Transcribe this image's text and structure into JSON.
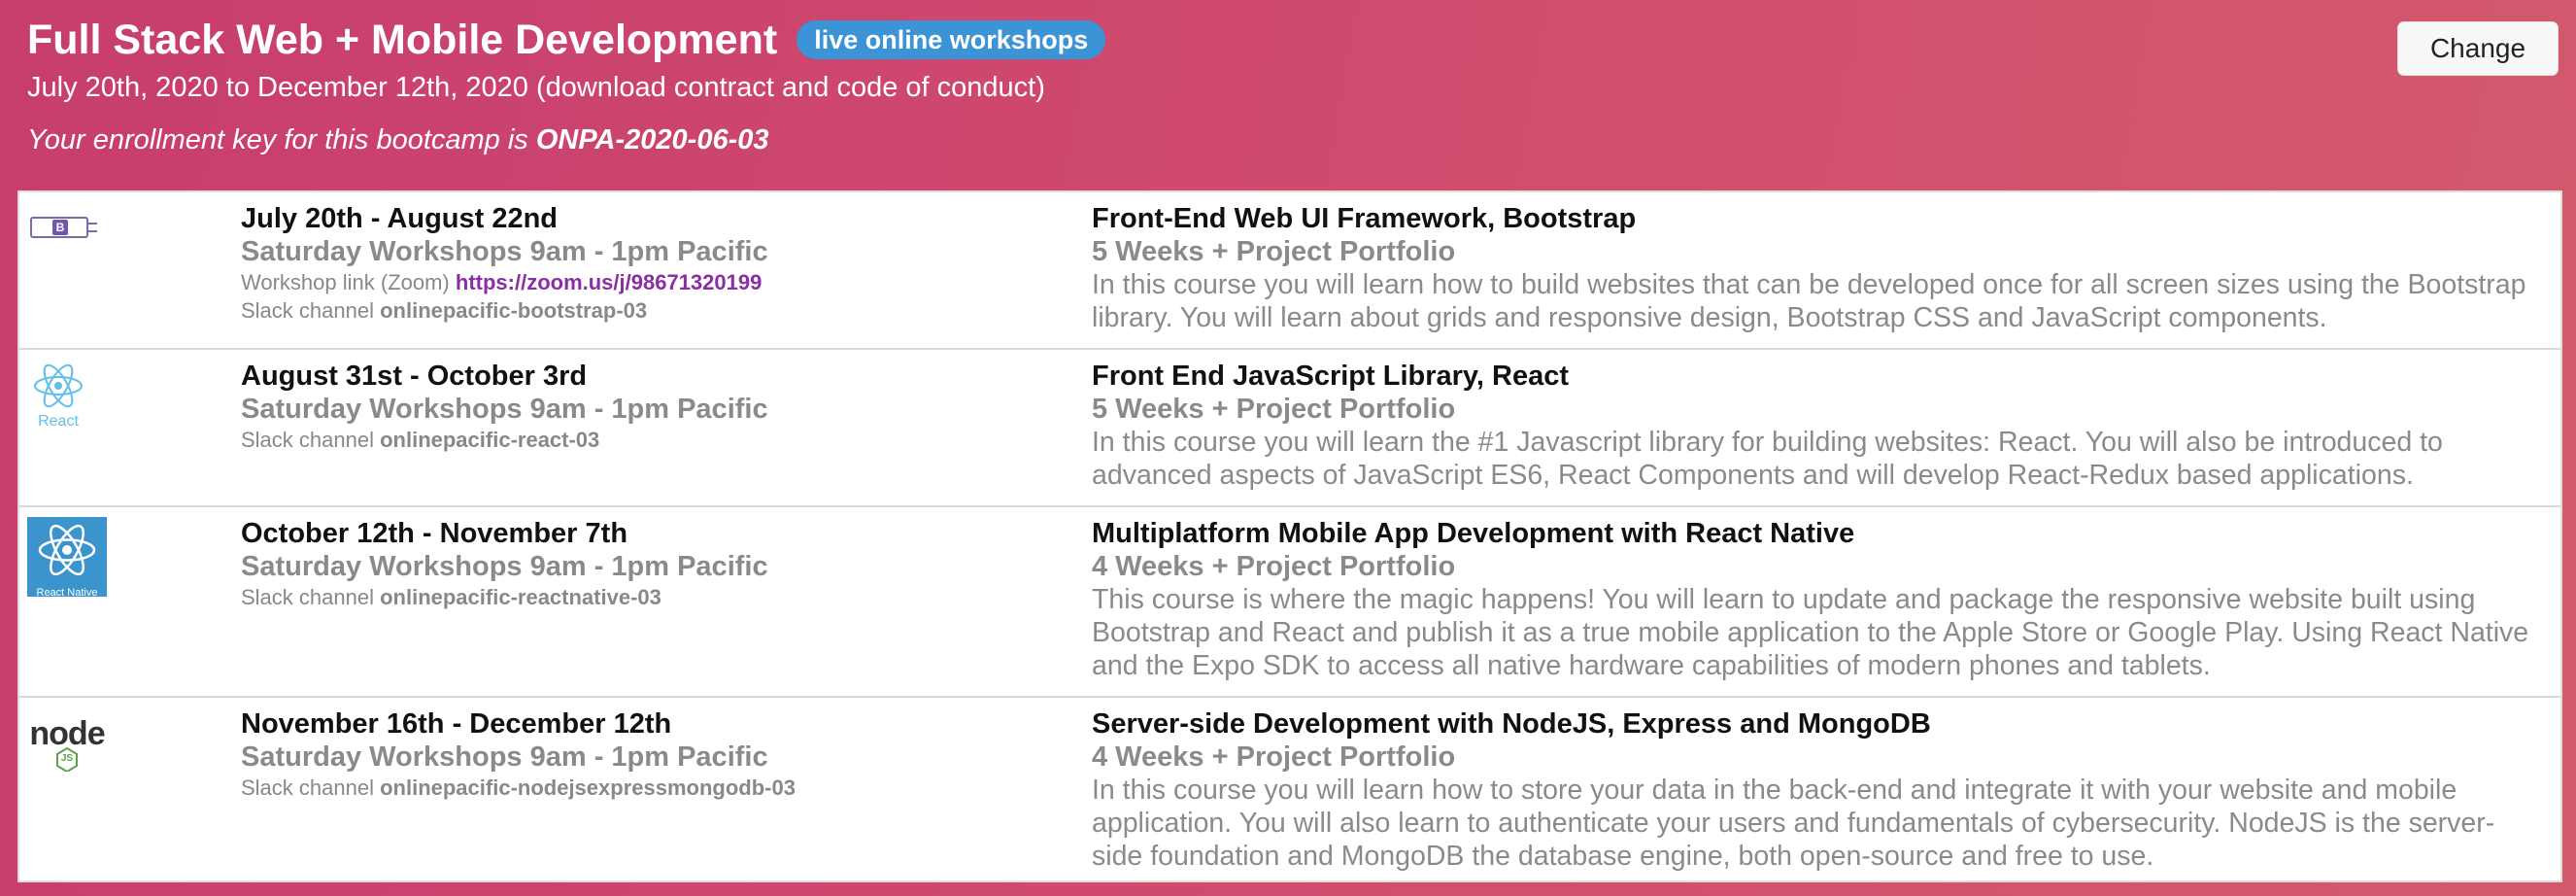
{
  "header": {
    "title": "Full Stack Web + Mobile Development",
    "badge": "live online workshops",
    "dates": "July 20th, 2020 to December 12th, 2020 (download contract and code of conduct)",
    "enrollment_prefix": "Your enrollment key for this bootcamp is ",
    "enrollment_key": "ONPA-2020-06-03",
    "change_label": "Change"
  },
  "courses": [
    {
      "logo_icon": "bootstrap-logo-icon",
      "date_range": "July 20th - August 22nd",
      "schedule": "Saturday Workshops 9am - 1pm Pacific",
      "workshop_label": "Workshop link (Zoom) ",
      "workshop_link": "https://zoom.us/j/98671320199",
      "slack_label": "Slack channel ",
      "slack_channel": "onlinepacific-bootstrap-03",
      "name": "Front-End Web UI Framework, Bootstrap",
      "duration": "5 Weeks + Project Portfolio",
      "description": "In this course you will learn how to build websites that can be developed once for all screen sizes using the Bootstrap library. You will learn about grids and responsive design, Bootstrap CSS and JavaScript components."
    },
    {
      "logo_icon": "react-logo-icon",
      "logo_text": "React",
      "date_range": "August 31st - October 3rd",
      "schedule": "Saturday Workshops 9am - 1pm Pacific",
      "slack_label": "Slack channel ",
      "slack_channel": "onlinepacific-react-03",
      "name": "Front End JavaScript Library, React",
      "duration": "5 Weeks + Project Portfolio",
      "description": "In this course you will learn the #1 Javascript library for building websites: React. You will also be introduced to advanced aspects of JavaScript ES6, React Components and will develop React-Redux based applications."
    },
    {
      "logo_icon": "react-native-logo-icon",
      "logo_text": "React Native",
      "date_range": "October 12th - November 7th",
      "schedule": "Saturday Workshops 9am - 1pm Pacific",
      "slack_label": "Slack channel ",
      "slack_channel": "onlinepacific-reactnative-03",
      "name": "Multiplatform Mobile App Development with React Native",
      "duration": "4 Weeks + Project Portfolio",
      "description": "This course is where the magic happens! You will learn to update and package the responsive website built using Bootstrap and React and publish it as a true mobile application to the Apple Store or Google Play. Using React Native and the Expo SDK to access all native hardware capabilities of modern phones and tablets."
    },
    {
      "logo_icon": "nodejs-logo-icon",
      "logo_text": "node",
      "logo_subtext": "JS",
      "date_range": "November 16th - December 12th",
      "schedule": "Saturday Workshops 9am - 1pm Pacific",
      "slack_label": "Slack channel ",
      "slack_channel": "onlinepacific-nodejsexpressmongodb-03",
      "name": "Server-side Development with NodeJS, Express and MongoDB",
      "duration": "4 Weeks + Project Portfolio",
      "description": "In this course you will learn how to store your data in the back-end and integrate it with your website and mobile application. You will also learn to authenticate your users and fundamentals of cybersecurity. NodeJS is the server-side foundation and MongoDB the database engine, both open-source and free to use."
    }
  ]
}
